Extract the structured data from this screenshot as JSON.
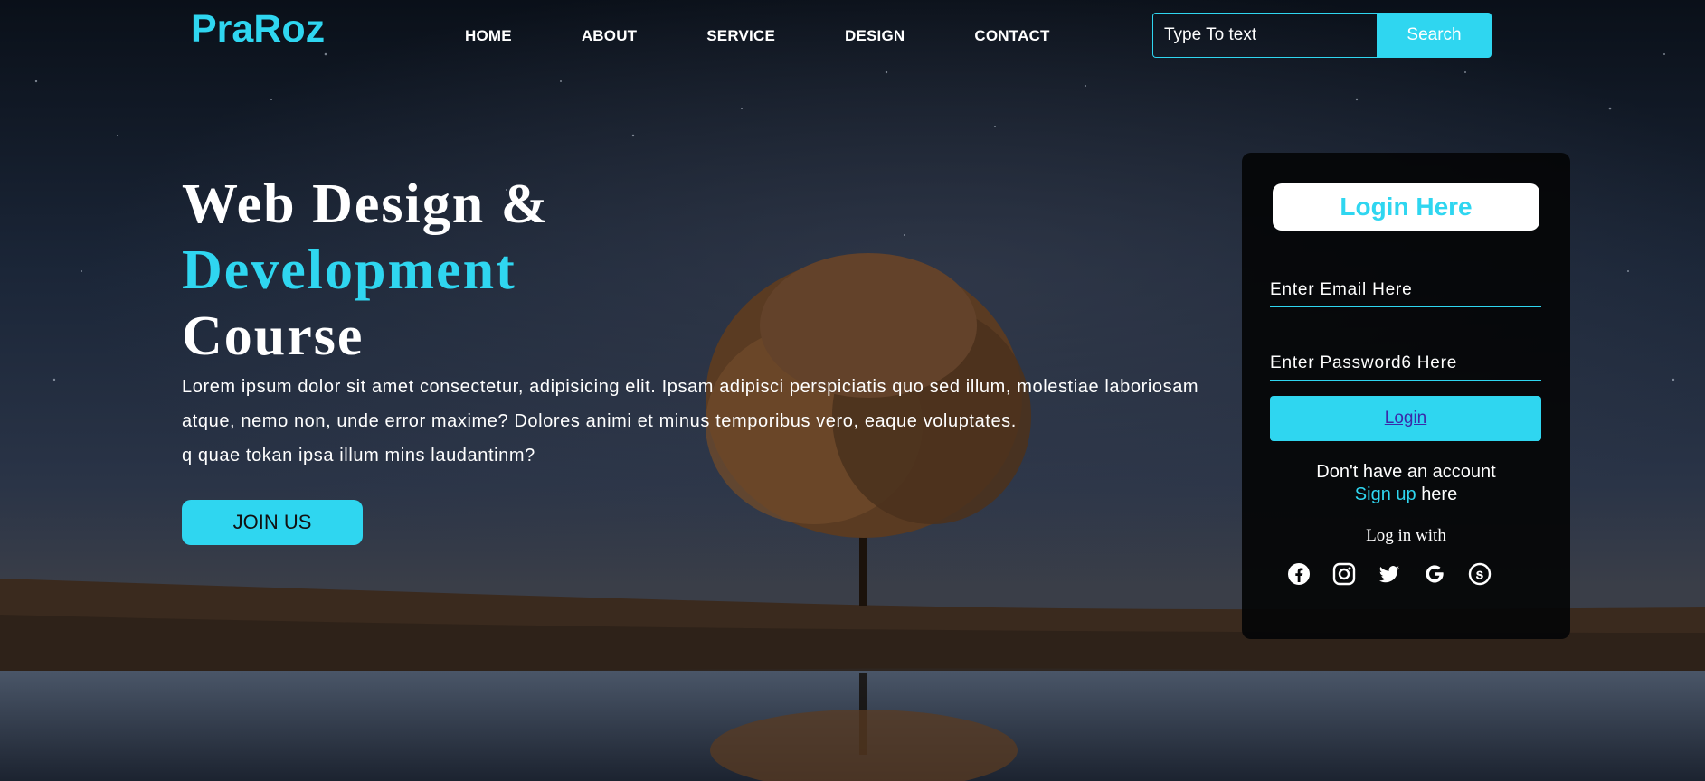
{
  "header": {
    "logo": "PraRoz",
    "nav": [
      "HOME",
      "ABOUT",
      "SERVICE",
      "DESIGN",
      "CONTACT"
    ],
    "search": {
      "placeholder": "Type To text",
      "button": "Search"
    }
  },
  "hero": {
    "title_line1": "Web Design &",
    "title_line2": "Development",
    "title_line3": "Course",
    "paragraph": "Lorem ipsum dolor sit amet consectetur, adipisicing elit. Ipsam adipisci perspiciatis quo sed illum, molestiae laboriosam atque, nemo non, unde error maxime? Dolores animi et minus temporibus vero, eaque voluptates.",
    "paragraph2": "q quae tokan ipsa illum mins laudantinm?",
    "join_button": "JOIN US"
  },
  "login": {
    "title": "Login Here",
    "email_placeholder": "Enter Email Here",
    "password_placeholder": "Enter Password6 Here",
    "login_button": "Login",
    "signup_prefix": "Don't have an account",
    "signup_link": "Sign up",
    "signup_suffix": "here",
    "login_with": "Log in with",
    "socials": [
      "facebook-icon",
      "instagram-icon",
      "twitter-icon",
      "google-icon",
      "skype-icon"
    ]
  },
  "colors": {
    "accent": "#2fd6f0",
    "card": "#050608",
    "sky": "#0c1320"
  }
}
